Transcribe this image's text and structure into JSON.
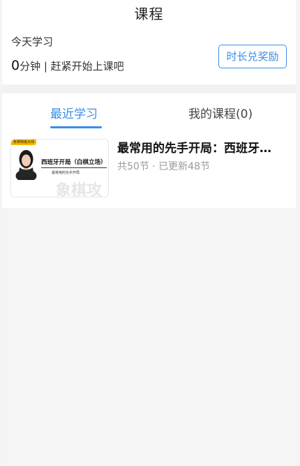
{
  "header": {
    "title": "课程",
    "today_label": "今天学习",
    "today_minutes": "0",
    "today_suffix": "分钟 | 赶紧开始上课吧",
    "reward_button": "时长兑奖励"
  },
  "tabs": [
    {
      "label": "最近学习",
      "active": true
    },
    {
      "label": "我的课程(0)",
      "active": false
    }
  ],
  "courses": [
    {
      "title": "最常用的先手开局：西班牙…",
      "meta": "共50节 · 已更新48节",
      "thumbnail": {
        "tag": "象棋特级大师",
        "title": "西班牙开局（白棋立场）",
        "subtitle": "最常用的先手开局",
        "watermark": "象棋攻"
      }
    }
  ],
  "colors": {
    "accent": "#3a8ee6",
    "muted": "#9a9a9a",
    "tag": "#f5b800"
  }
}
